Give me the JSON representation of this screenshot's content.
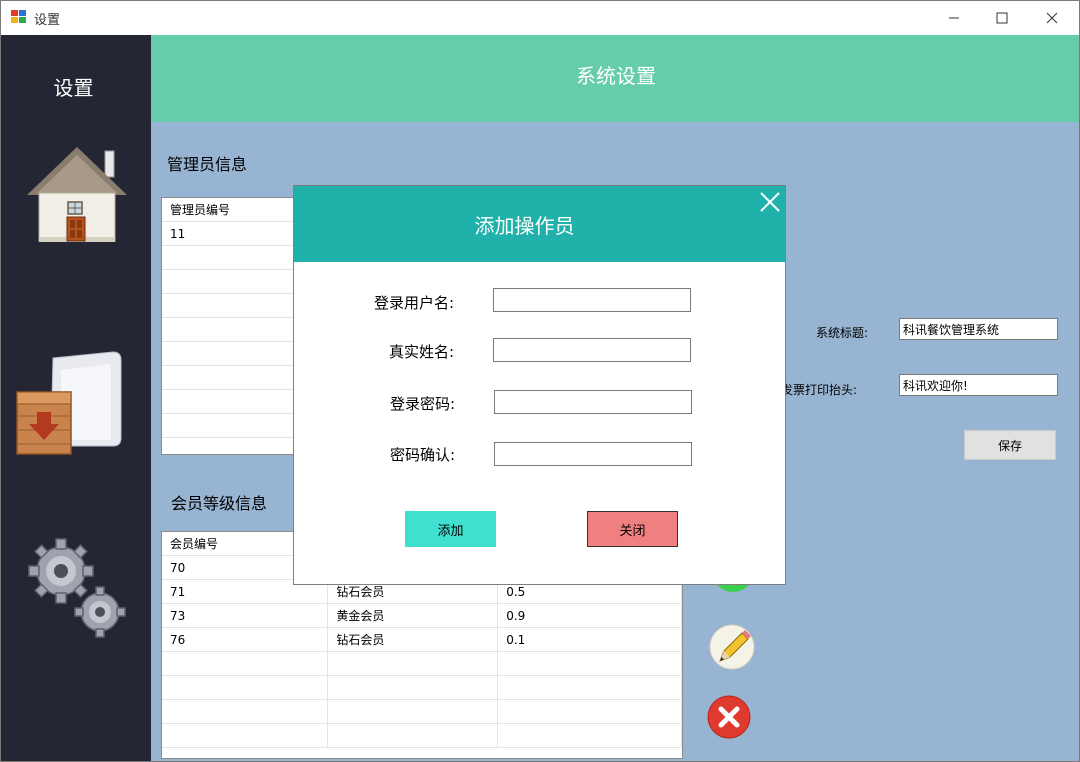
{
  "window": {
    "title": "设置"
  },
  "sidebar": {
    "title": "设置",
    "items": [
      {
        "icon": "house-icon"
      },
      {
        "icon": "folder-box-icon"
      },
      {
        "icon": "gears-icon"
      }
    ]
  },
  "header": {
    "title": "系统设置"
  },
  "admin_section": {
    "label": "管理员信息",
    "columns": [
      "管理员编号",
      "",
      ""
    ],
    "rows": [
      [
        "11",
        "",
        ""
      ]
    ]
  },
  "member_section": {
    "label": "会员等级信息",
    "columns": [
      "会员编号",
      "",
      ""
    ],
    "rows": [
      [
        "70",
        "",
        ""
      ],
      [
        "71",
        "钻石会员",
        "0.5"
      ],
      [
        "73",
        "黄金会员",
        "0.9"
      ],
      [
        "76",
        "钻石会员",
        "0.1"
      ]
    ]
  },
  "settings": {
    "system_title_label": "系统标题:",
    "system_title_value": "科讯餐饮管理系统",
    "invoice_header_label": "发票打印抬头:",
    "invoice_header_value": "科讯欢迎你!",
    "save_label": "保存"
  },
  "modal": {
    "title": "添加操作员",
    "fields": [
      {
        "label": "登录用户名:",
        "value": ""
      },
      {
        "label": "真实姓名:",
        "value": ""
      },
      {
        "label": "登录密码:",
        "value": ""
      },
      {
        "label": "密码确认:",
        "value": ""
      }
    ],
    "add_label": "添加",
    "close_label": "关闭"
  },
  "colors": {
    "sidebar": "#242733",
    "header": "#66cdaa",
    "content": "#97b4d2",
    "modal_header": "#20b2aa",
    "add_button": "#40e0d0",
    "close_button": "#f08080"
  }
}
